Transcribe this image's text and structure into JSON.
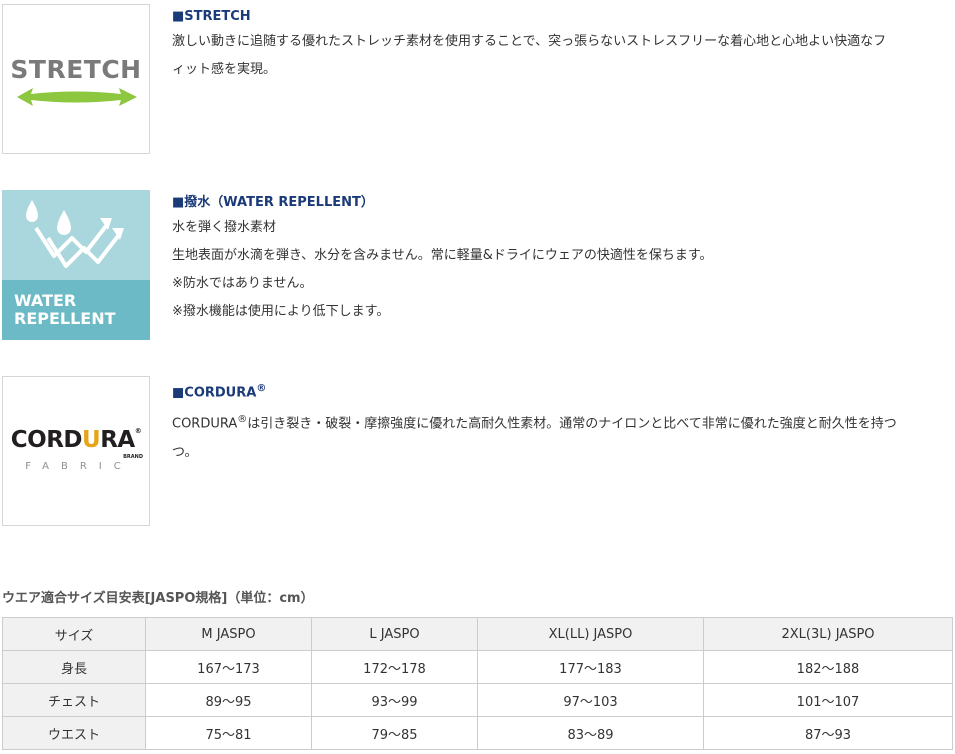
{
  "features": {
    "stretch": {
      "icon_name": "stretch-icon",
      "icon_label": "STRETCH",
      "title": "■STRETCH",
      "lines": [
        "激しい動きに追随する優れたストレッチ素材を使用することで、突っ張らないストレスフリーな着心地と心地よい快適なフ",
        "ィット感を実現。"
      ],
      "colors": {
        "arrow": "#8dc63f",
        "word": "#7a7a7a"
      }
    },
    "water_repellent": {
      "icon_name": "water-repellent-icon",
      "icon_label_line1": "WATER",
      "icon_label_line2": "REPELLENT",
      "title": "■撥水（WATER REPELLENT）",
      "lines": [
        "水を弾く撥水素材",
        "生地表面が水滴を弾き、水分を含みません。常に軽量&ドライにウェアの快適性を保ちます。",
        "※防水ではありません。",
        "※撥水機能は使用により低下します。"
      ],
      "colors": {
        "top": "#a9d7dd",
        "bottom": "#6bbac5"
      }
    },
    "cordura": {
      "icon_name": "cordura-fabric-logo",
      "logo_word_start": "CORD",
      "logo_word_accent": "U",
      "logo_word_end": "RA",
      "logo_reg": "®",
      "logo_brand": "BRAND",
      "logo_fabric": "FABRIC",
      "title": "■CORDURA",
      "title_reg": "®",
      "line_prefix": "CORDURA",
      "line_reg": "®",
      "line_rest": "は引き裂き・破裂・摩擦強度に優れた高耐久性素材。通常のナイロンと比べて非常に優れた強度と耐久性を持つ",
      "line_cont": "つ。",
      "colors": {
        "accent": "#e6a519"
      }
    }
  },
  "size_table": {
    "caption": "ウエア適合サイズ目安表[JASPO規格]（単位：cm）",
    "columns": [
      "サイズ",
      "M JASPO",
      "L JASPO",
      "XL(LL) JASPO",
      "2XL(3L) JASPO"
    ],
    "rows": [
      {
        "label": "身長",
        "values": [
          "167～173",
          "172～178",
          "177～183",
          "182～188"
        ]
      },
      {
        "label": "チェスト",
        "values": [
          "89～95",
          "93～99",
          "97～103",
          "101～107"
        ]
      },
      {
        "label": "ウエスト",
        "values": [
          "75～81",
          "79～85",
          "83～89",
          "87～93"
        ]
      }
    ]
  },
  "colors": {
    "title_blue": "#1a3a78",
    "text": "#333333",
    "table_border": "#cccccc",
    "table_header_bg": "#f1f1f1"
  }
}
